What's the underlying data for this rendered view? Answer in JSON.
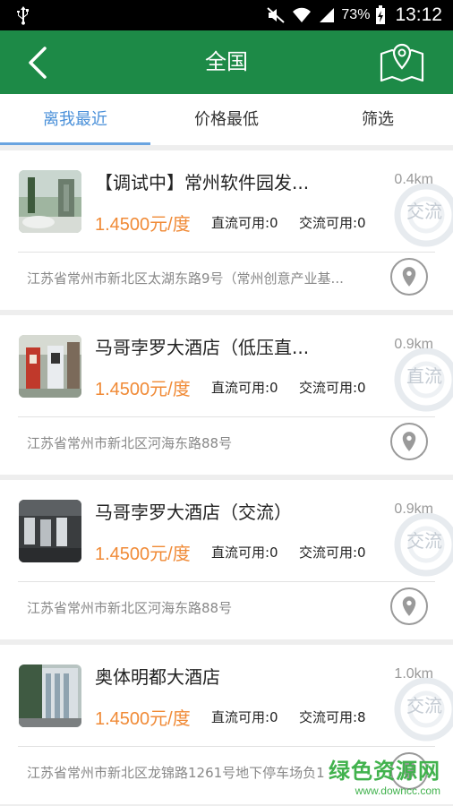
{
  "status_bar": {
    "battery_pct": "73%",
    "time": "13:12"
  },
  "header": {
    "title": "全国",
    "back_icon": "chevron-left-icon",
    "map_icon": "map-pin-icon",
    "bg_color": "#1d8a47"
  },
  "tabs": [
    {
      "label": "离我最近",
      "active": true
    },
    {
      "label": "价格最低",
      "active": false
    },
    {
      "label": "筛选",
      "active": false
    }
  ],
  "stations": [
    {
      "name": "【调试中】常州软件园发...",
      "price": "1.4500元/度",
      "dc": "直流可用:0",
      "ac": "交流可用:0",
      "distance": "0.4km",
      "type": "交流",
      "address": "江苏省常州市新北区太湖东路9号（常州创意产业基..."
    },
    {
      "name": "马哥孛罗大酒店（低压直...",
      "price": "1.4500元/度",
      "dc": "直流可用:0",
      "ac": "交流可用:0",
      "distance": "0.9km",
      "type": "直流",
      "address": "江苏省常州市新北区河海东路88号"
    },
    {
      "name": "马哥孛罗大酒店（交流）",
      "price": "1.4500元/度",
      "dc": "直流可用:0",
      "ac": "交流可用:0",
      "distance": "0.9km",
      "type": "交流",
      "address": "江苏省常州市新北区河海东路88号"
    },
    {
      "name": "奥体明都大酒店",
      "price": "1.4500元/度",
      "dc": "直流可用:0",
      "ac": "交流可用:8",
      "distance": "1.0km",
      "type": "交流",
      "address": "江苏省常州市新北区龙锦路1261号地下停车场负1"
    }
  ],
  "watermark": {
    "site_name": "绿色资源网",
    "site_url": "www.downcc.com"
  },
  "colors": {
    "accent_green": "#1d8a47",
    "price_orange": "#f08a36",
    "tab_blue": "#4a90d9"
  }
}
